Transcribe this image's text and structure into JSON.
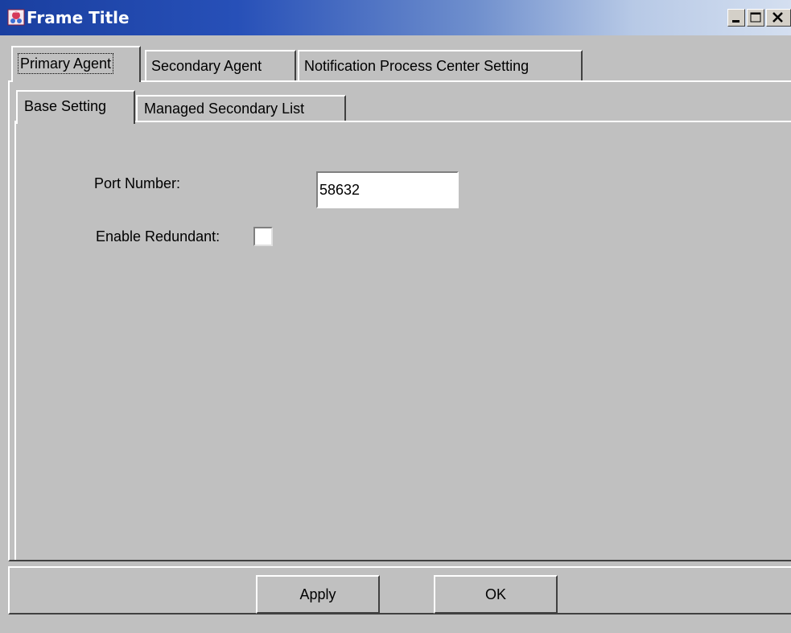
{
  "window": {
    "title": "Frame Title",
    "icons": {
      "app": "java-app-icon",
      "minimize": "minimize-icon",
      "maximize": "maximize-icon",
      "close": "close-icon"
    }
  },
  "outer_tabs": [
    {
      "label": "Primary Agent",
      "active": true
    },
    {
      "label": "Secondary Agent",
      "active": false
    },
    {
      "label": "Notification Process Center Setting",
      "active": false
    }
  ],
  "inner_tabs": [
    {
      "label": "Base Setting",
      "active": true
    },
    {
      "label": "Managed Secondary List",
      "active": false
    }
  ],
  "form": {
    "port_label": "Port Number:",
    "port_value": "58632",
    "redundant_label": "Enable Redundant:",
    "redundant_checked": false
  },
  "buttons": {
    "apply": "Apply",
    "ok": "OK"
  },
  "colors": {
    "window_background": "#c0c0c0",
    "titlebar_start": "#1a3fa0",
    "titlebar_end": "#d4dff0",
    "title_text": "#ffffff"
  }
}
